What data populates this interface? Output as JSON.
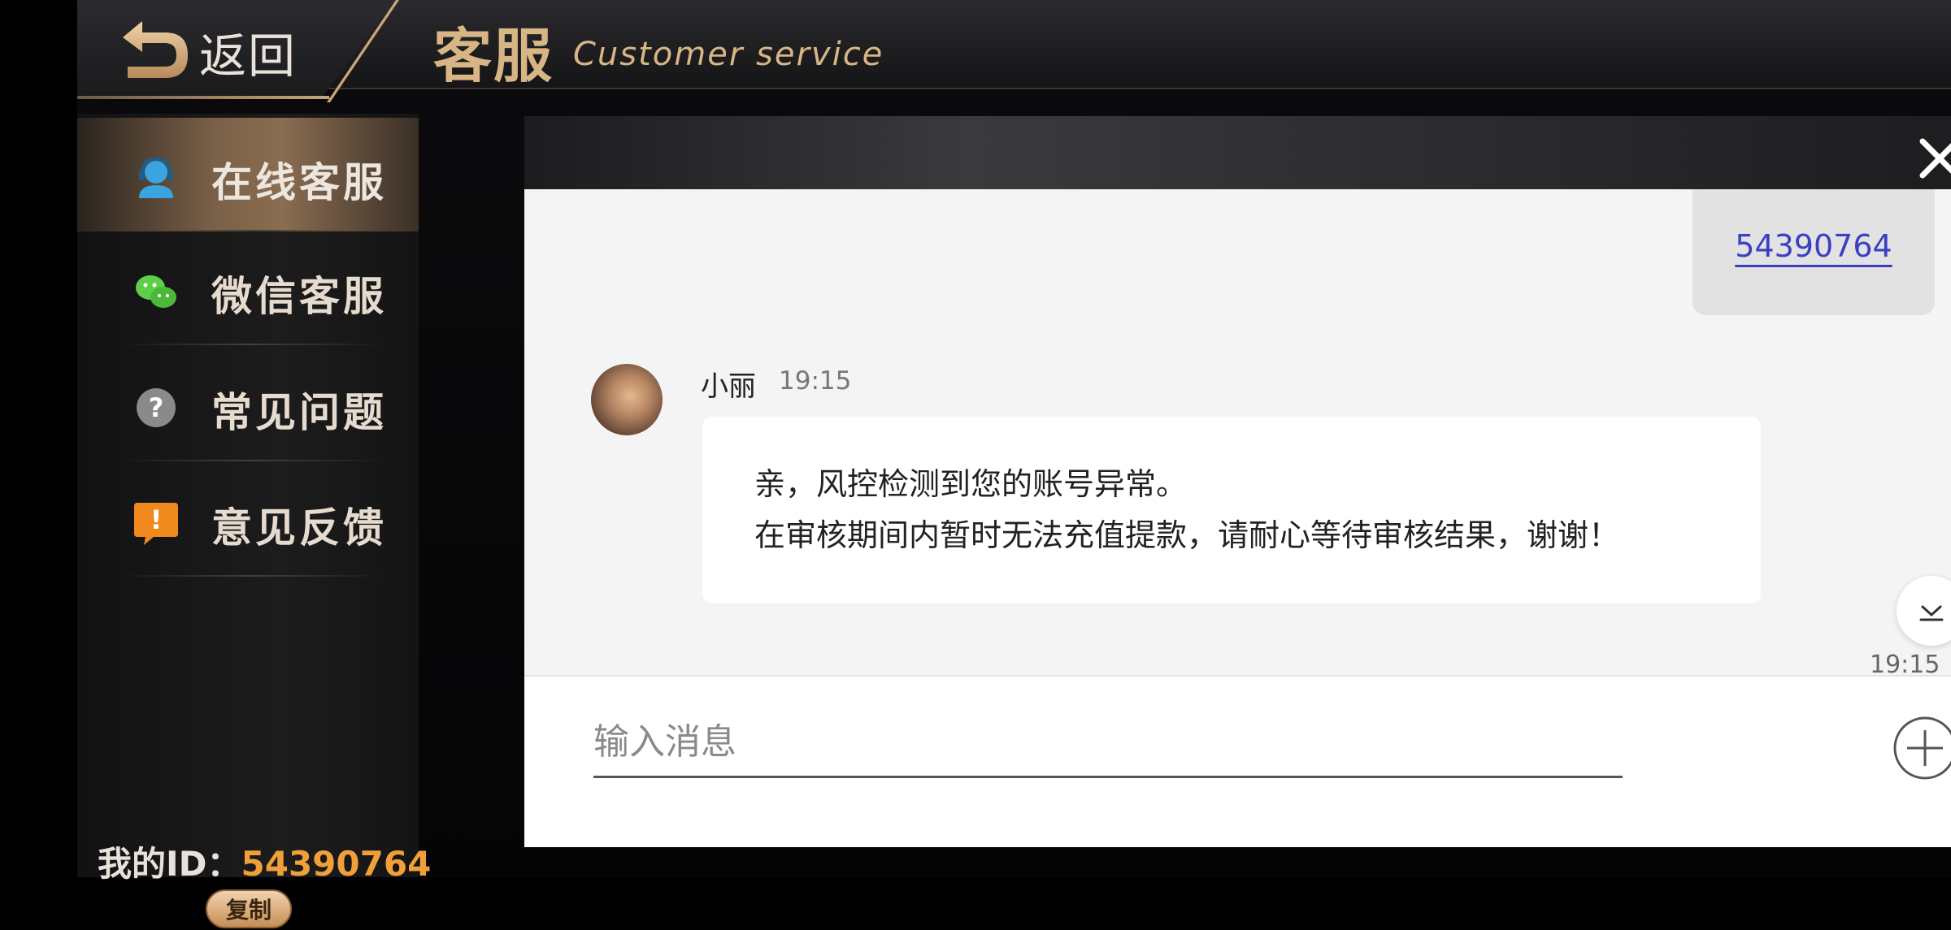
{
  "header": {
    "back_label": "返回",
    "title_cn": "客服",
    "title_en": "Customer service"
  },
  "sidebar": {
    "items": [
      {
        "label": "在线客服",
        "icon": "headset-user-icon",
        "active": true
      },
      {
        "label": "微信客服",
        "icon": "wechat-icon",
        "active": false
      },
      {
        "label": "常见问题",
        "icon": "question-icon",
        "active": false
      },
      {
        "label": "意见反馈",
        "icon": "feedback-icon",
        "active": false
      }
    ],
    "id_label": "我的ID：",
    "id_value": "54390764",
    "copy_label": "复制"
  },
  "chat": {
    "sent_message": "54390764",
    "agent_name": "小丽",
    "agent_time": "19:15",
    "agent_message_line1": "亲，风控检测到您的账号异常。",
    "agent_message_line2": "在审核期间内暂时无法充值提款，请耐心等待审核结果，谢谢！",
    "bottom_time": "19:15",
    "input_placeholder": "输入消息"
  },
  "colors": {
    "accent_gold": "#d8b585",
    "id_orange": "#f0a03a",
    "link_blue": "#3a3fc4"
  }
}
